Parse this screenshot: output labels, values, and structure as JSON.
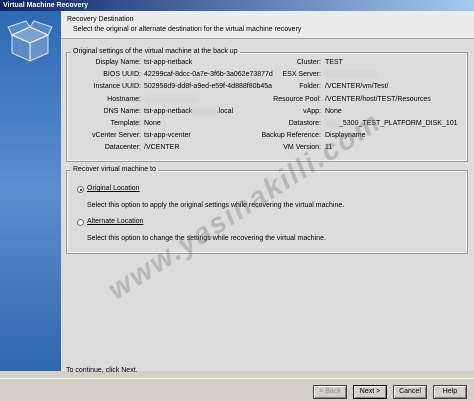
{
  "window": {
    "title": "Virtual Machine Recovery"
  },
  "header": {
    "title": "Recovery Destination",
    "subtitle": "Select the original or alternate destination for the virtual machine recovery"
  },
  "original_settings": {
    "title": "Original settings of the virtual machine at the back up",
    "left": [
      {
        "label": "Display Name:",
        "value": "tst-app-netback"
      },
      {
        "label": "BIOS UUID:",
        "value": "42299caf-8dcc-0a7e-3f6b-3a062e73877d"
      },
      {
        "label": "Instance UUID:",
        "value": "502958d9-dd8f-a9ed-e59f-4d888f80b45a"
      },
      {
        "label": "Hostname:",
        "value": ""
      },
      {
        "label": "DNS Name:",
        "value": "tst-app-netback",
        "suffix": ".local"
      },
      {
        "label": "Template:",
        "value": "None"
      },
      {
        "label": "vCenter Server:",
        "value": "tst-app-vcenter"
      },
      {
        "label": "Datacenter:",
        "value": "/VCENTER"
      }
    ],
    "right": [
      {
        "label": "Cluster:",
        "value": "TEST"
      },
      {
        "label": "ESX Server:",
        "value": ""
      },
      {
        "label": "Folder:",
        "value": "/VCENTER/vm/Test/"
      },
      {
        "label": "Resource Pool:",
        "value": "/VCENTER/host/TEST/Resources"
      },
      {
        "label": "vApp:",
        "value": "None"
      },
      {
        "label": "Datastore:",
        "value": "_5300_TEST_PLATFORM_DISK_101"
      },
      {
        "label": "Backup Reference:",
        "value": "Displayname"
      },
      {
        "label": "VM Version:",
        "value": "11"
      }
    ]
  },
  "recover_group": {
    "title": "Recover virtual machine to",
    "original": {
      "label": "Original Location",
      "description": "Select this option to apply the original settings while recovering the virtual machine.",
      "checked": true
    },
    "alternate": {
      "label": "Alternate Location",
      "description": "Select this option to change the settings while recovering the virtual machine.",
      "checked": false
    }
  },
  "footer": {
    "hint": "To continue, click Next.",
    "back_label": "< Back",
    "next_label": "Next >",
    "cancel_label": "Cancel",
    "help_label": "Help"
  },
  "watermark": "www.yasinakilli.com"
}
